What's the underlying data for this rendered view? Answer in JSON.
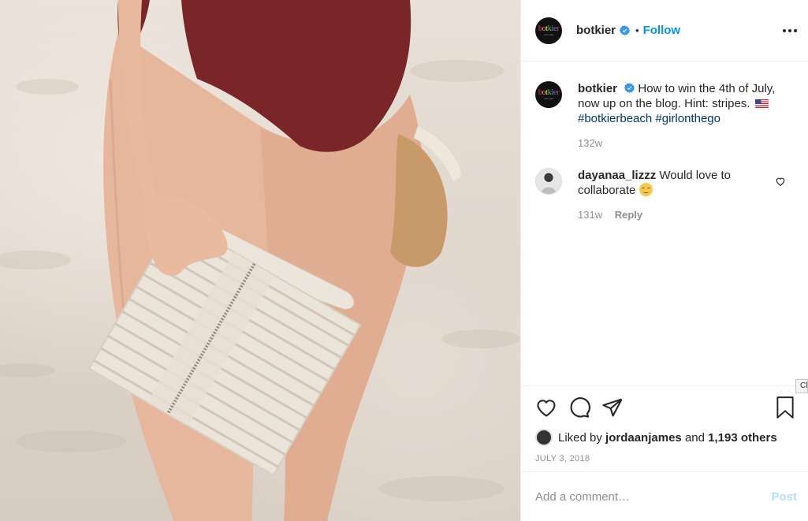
{
  "post": {
    "image_alt": "Woman in a burgundy swimsuit holding a striped clutch and sandals on the beach",
    "author": "botkier",
    "brand_mark": "botkier",
    "brand_sub": "new york",
    "follow_label": "Follow",
    "caption": {
      "user": "botkier",
      "text": "How to win the 4th of July, now up on the blog. Hint: stripes.",
      "hashtags": [
        "#botkierbeach",
        "#girlonthego"
      ],
      "age": "132w"
    },
    "comments": [
      {
        "user": "dayanaa_lizzz",
        "text": "Would love to collaborate",
        "age": "131w",
        "reply_label": "Reply"
      }
    ],
    "likes": {
      "prefix": "Liked by",
      "user": "jordaanjames",
      "joiner": "and",
      "count": "1,193 others"
    },
    "date": "JULY 3, 2018",
    "compose": {
      "placeholder": "Add a comment…",
      "post_label": "Post"
    },
    "tooltip_text": "Cl"
  },
  "colors": {
    "accent": "#0095f6",
    "hashtag": "#00376b",
    "muted": "#8e8e8e",
    "post_disabled": "#b2dffc"
  }
}
